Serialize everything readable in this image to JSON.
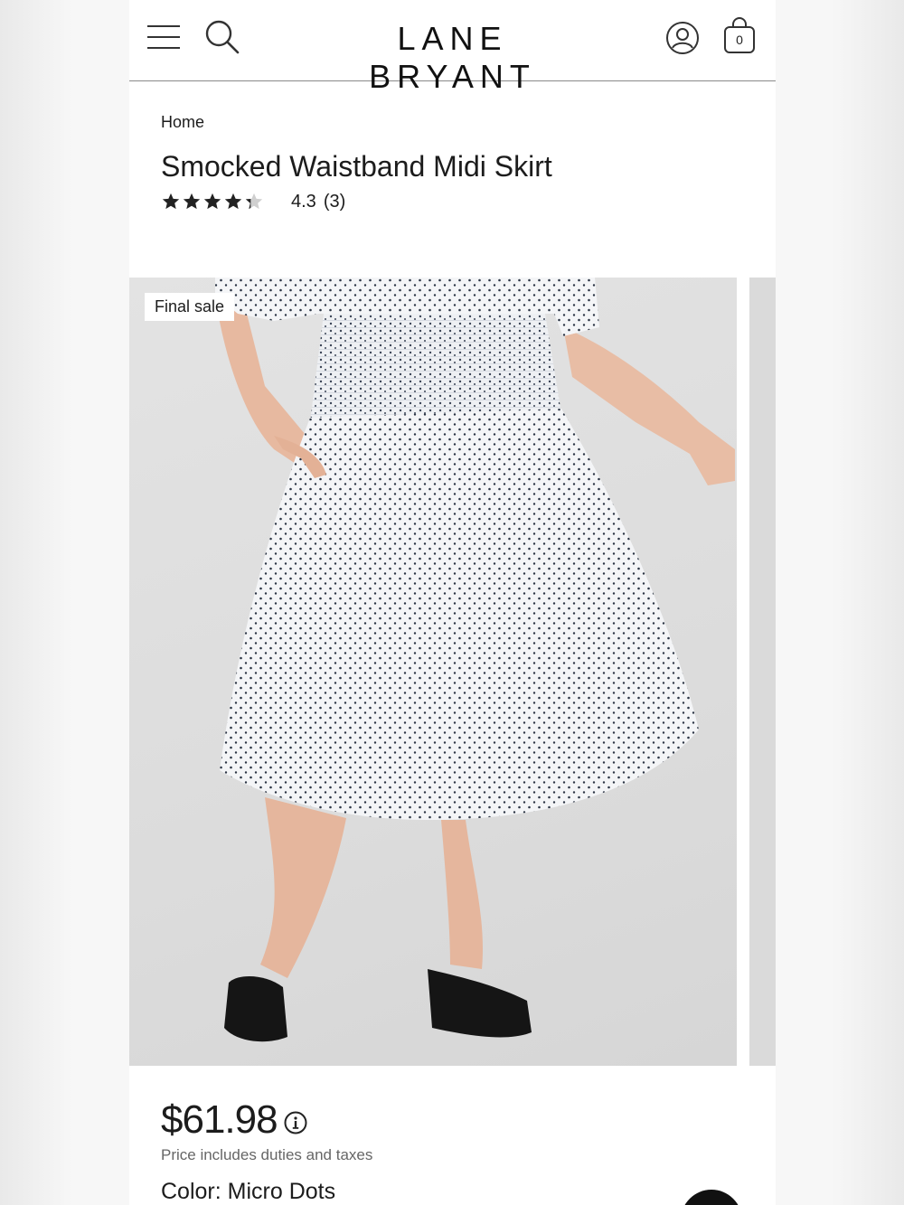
{
  "header": {
    "brand": "LANE BRYANT",
    "bag_count": "0"
  },
  "breadcrumb": "Home",
  "product": {
    "title": "Smocked Waistband Midi Skirt",
    "rating_value": "4.3",
    "rating_count": "(3)",
    "rating": 4.3,
    "badge": "Final sale",
    "price": "$61.98",
    "price_note": "Price includes duties and taxes",
    "color_label": "Color:",
    "color_value": "Micro Dots"
  },
  "colors": {
    "text": "#1c1c1c",
    "muted": "#666666",
    "divider": "#8a8a8a"
  },
  "icons": [
    "menu-icon",
    "search-icon",
    "account-icon",
    "bag-icon",
    "star-icon",
    "info-icon"
  ]
}
